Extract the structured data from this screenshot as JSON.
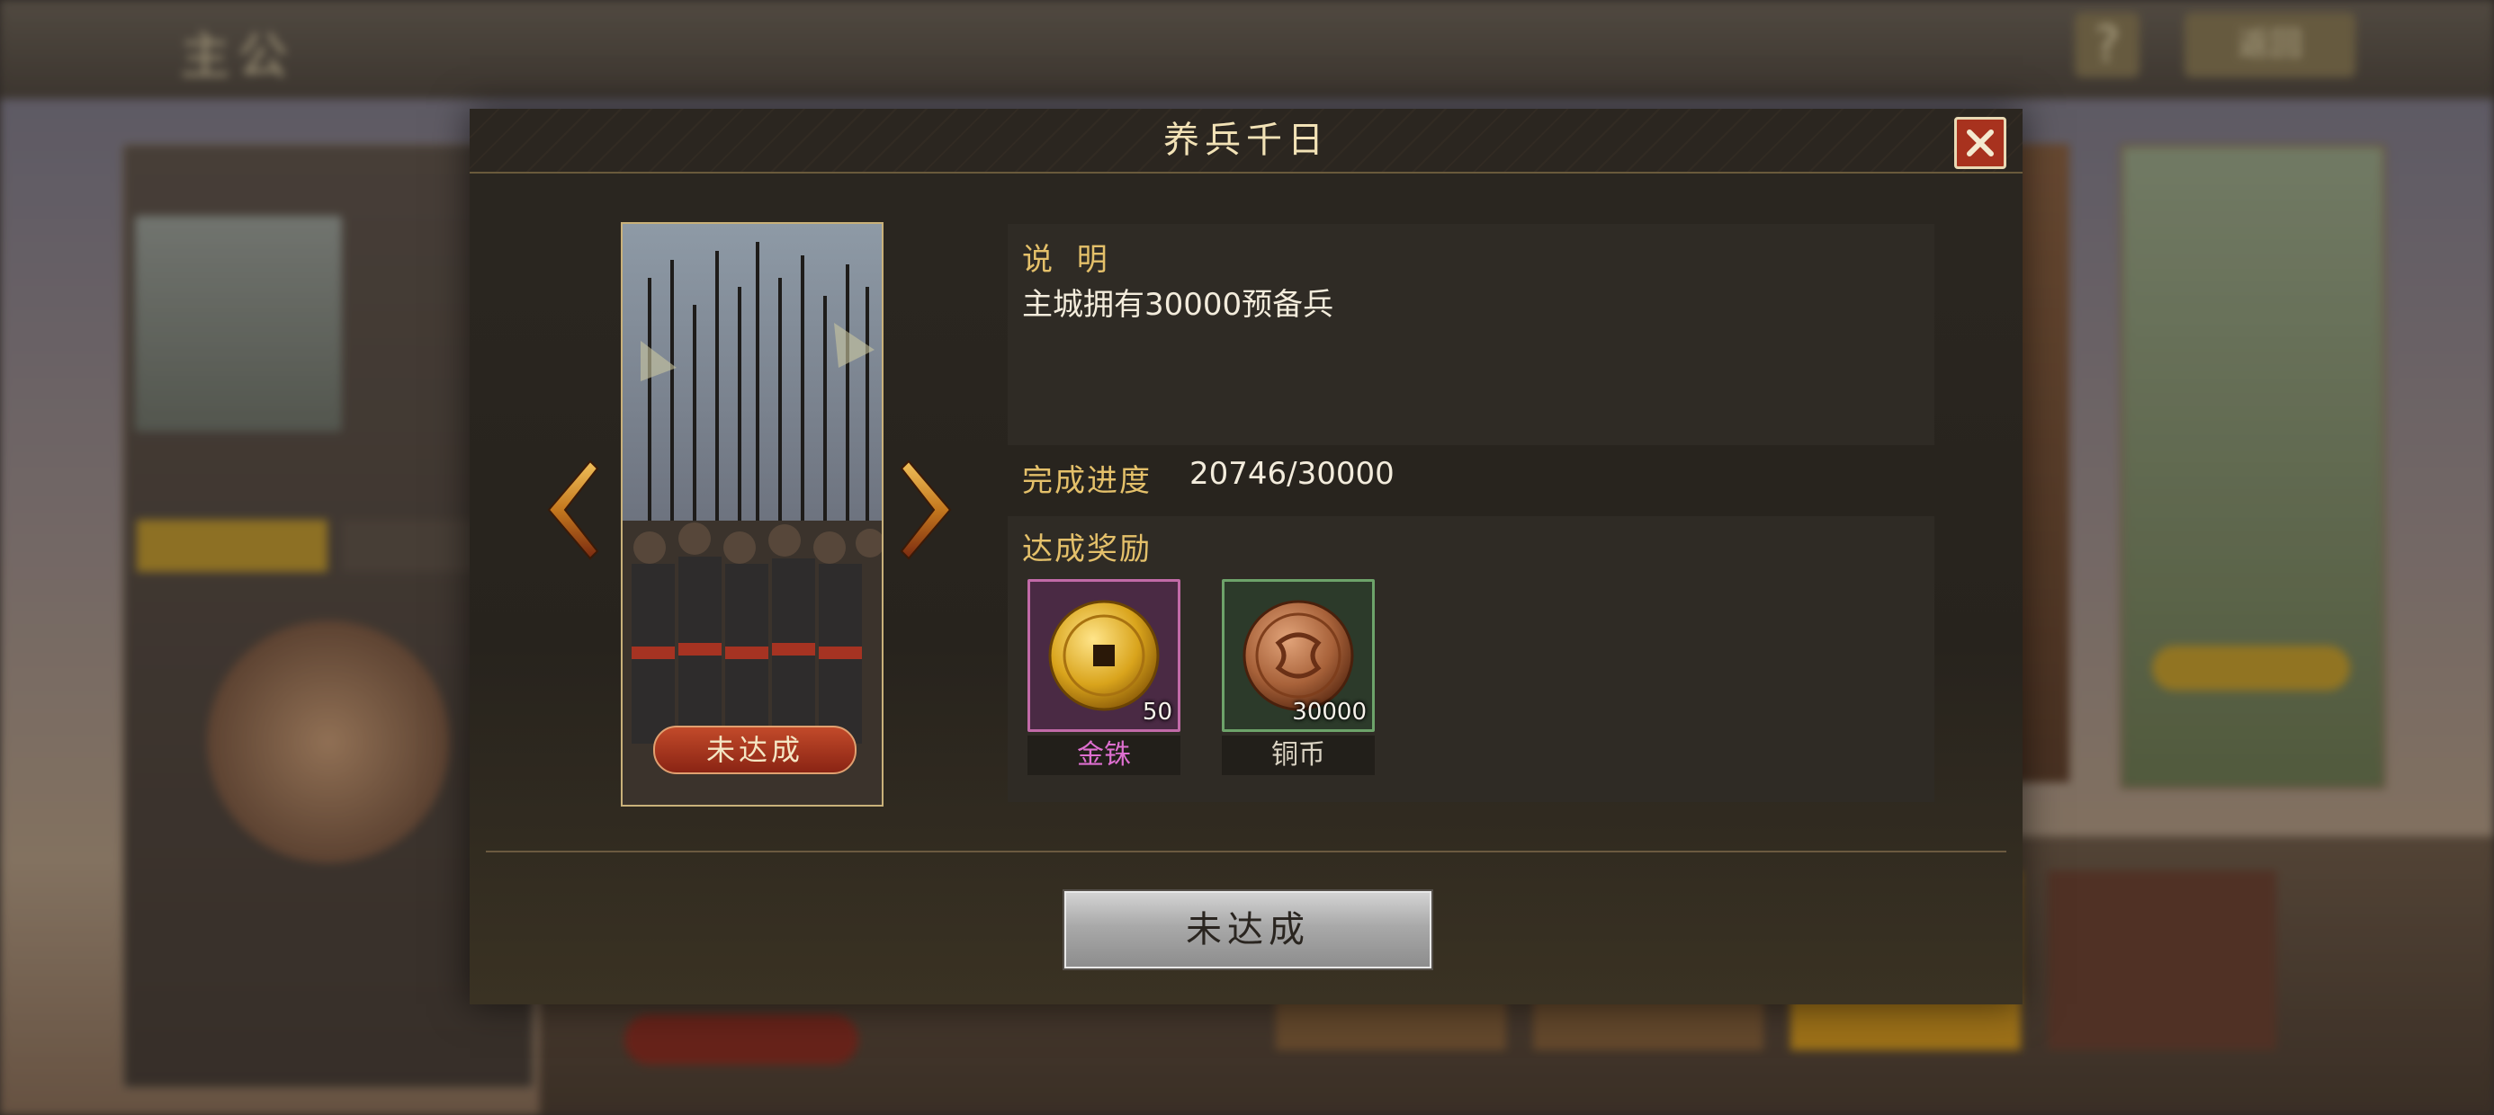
{
  "background": {
    "screen_title": "主公",
    "help_label": "?",
    "back_label": "返回"
  },
  "dialog": {
    "title": "养兵千日",
    "card": {
      "status": "未达成"
    },
    "description": {
      "label": "说 明",
      "text": "主城拥有30000预备兵"
    },
    "progress": {
      "label": "完成进度",
      "value": "20746/30000",
      "current": 20746,
      "target": 30000
    },
    "rewards": {
      "label": "达成奖励",
      "items": [
        {
          "name": "金铢",
          "quantity": "50",
          "icon": "gold-coin-icon",
          "color": "#de6fd0"
        },
        {
          "name": "铜币",
          "quantity": "30000",
          "icon": "copper-coin-icon",
          "color": "#d9d2c2"
        }
      ]
    },
    "action_button": "未达成"
  },
  "colors": {
    "accent_gold": "#e4c06a",
    "close_red": "#a8321e",
    "status_red": "#c24a2a"
  }
}
